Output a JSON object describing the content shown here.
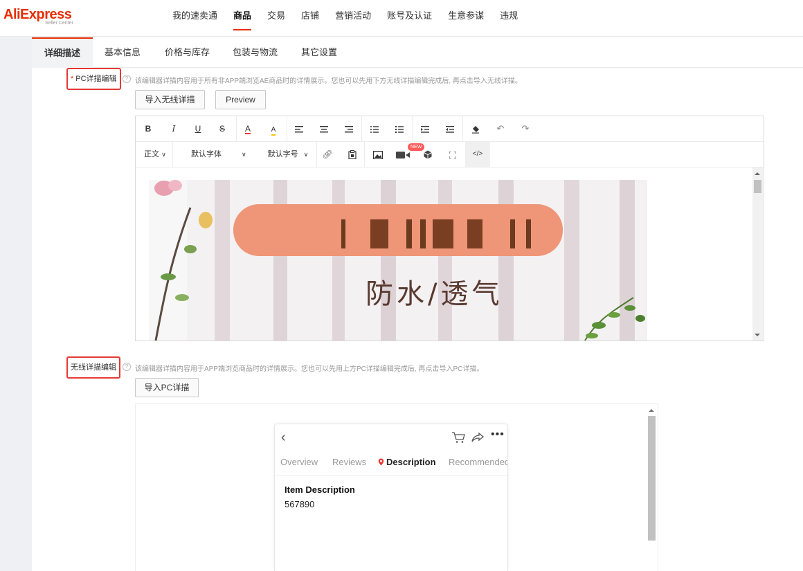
{
  "header": {
    "logo_main": "AliExpress",
    "logo_sub": "Seller Center",
    "nav": [
      "我的速卖通",
      "商品",
      "交易",
      "店铺",
      "营销活动",
      "账号及认证",
      "生意参谋",
      "违规"
    ],
    "active_nav": "商品"
  },
  "tabs": [
    "详细描述",
    "基本信息",
    "价格与库存",
    "包装与物流",
    "其它设置"
  ],
  "pc_section": {
    "required_mark": "*",
    "label": "PC详描编辑",
    "hint": "该编辑器详描内容用于所有非APP端浏览AE商品时的详情展示。您也可以先用下方无线详描编辑完成后, 再点击导入无线详描。",
    "import_button": "导入无线详描",
    "preview_button": "Preview"
  },
  "toolbar": {
    "row1": [
      {
        "icon": "bold-icon",
        "glyph": "B"
      },
      {
        "icon": "italic-icon",
        "glyph": "I"
      },
      {
        "icon": "underline-icon",
        "glyph": "U"
      },
      {
        "icon": "strikethrough-icon",
        "glyph": "S"
      },
      {
        "icon": "font-color-icon",
        "glyph": "A"
      },
      {
        "icon": "highlight-icon",
        "glyph": "A"
      },
      {
        "icon": "align-left-icon",
        "glyph": "≡"
      },
      {
        "icon": "align-center-icon",
        "glyph": "≡"
      },
      {
        "icon": "align-right-icon",
        "glyph": "≡"
      },
      {
        "icon": "bullet-list-icon",
        "glyph": "☰"
      },
      {
        "icon": "numbered-list-icon",
        "glyph": "☰"
      },
      {
        "icon": "indent-icon",
        "glyph": "⇥"
      },
      {
        "icon": "outdent-icon",
        "glyph": "⇤"
      },
      {
        "icon": "eraser-icon",
        "glyph": "◆"
      },
      {
        "icon": "undo-icon",
        "glyph": "↶"
      },
      {
        "icon": "redo-icon",
        "glyph": "↷"
      }
    ],
    "paragraph_select": "正文",
    "font_select": "默认字体",
    "size_select": "默认字号",
    "new_badge": "NEW"
  },
  "banner": {
    "title_text": "防水/透气",
    "colors": {
      "pill": "#ee9677",
      "pill_text": "#6b3a1f",
      "caption": "#5a3a30"
    }
  },
  "mobile_section": {
    "label": "无线详描编辑",
    "hint": "该编辑器详描内容用于APP端浏览商品时的详情展示。您也可以先用上方PC详描编辑完成后, 再点击导入PC详描。",
    "import_button": "导入PC详描"
  },
  "phone_preview": {
    "tabs": [
      "Overview",
      "Reviews",
      "Description",
      "Recommended"
    ],
    "active_tab": "Description",
    "item_title": "Item Description",
    "item_value": "567890"
  },
  "colors": {
    "accent": "#e62e04",
    "annotation_box": "#e53935"
  }
}
